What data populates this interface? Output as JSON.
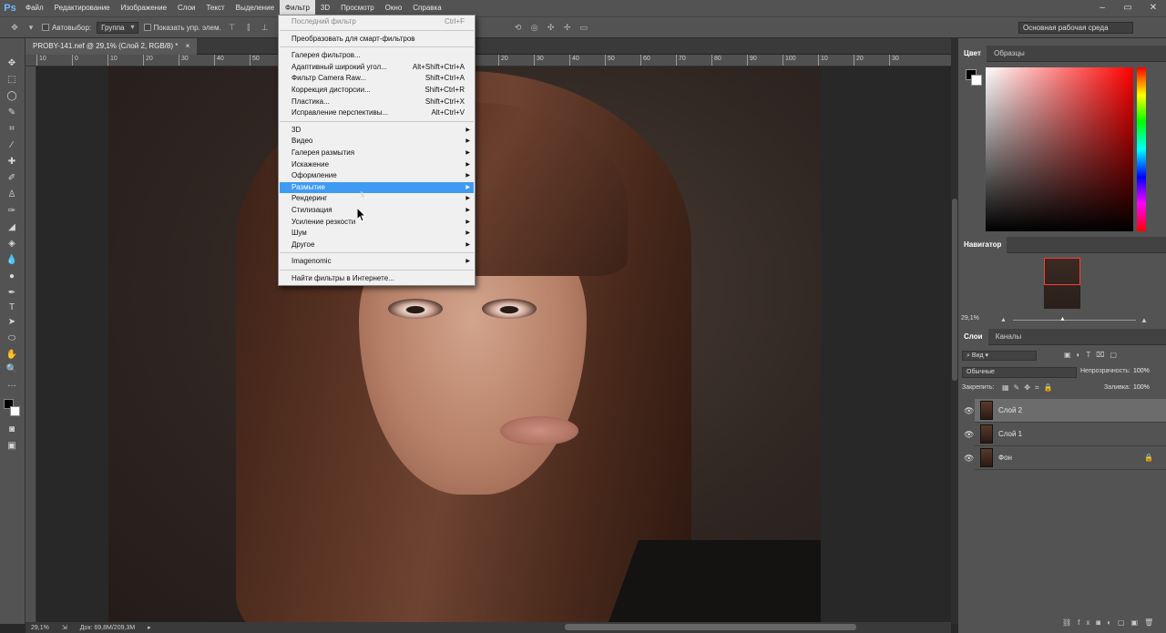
{
  "app": {
    "logo": "Ps"
  },
  "menubar": {
    "items": [
      "Файл",
      "Редактирование",
      "Изображение",
      "Слои",
      "Текст",
      "Выделение",
      "Фильтр",
      "3D",
      "Просмотр",
      "Окно",
      "Справка"
    ],
    "active_index": 6
  },
  "options": {
    "autoselect_label": "Автовыбор:",
    "autoselect_value": "Группа",
    "show_controls_label": "Показать упр. элем.",
    "workspace": "Основная рабочая среда"
  },
  "document": {
    "tab_title": "PROBY-141.nef @ 29,1% (Слой 2, RGB/8) *",
    "ruler_ticks": [
      "10",
      "0",
      "10",
      "20",
      "30",
      "40",
      "50",
      "60",
      "70",
      "80",
      "90",
      "100",
      "10",
      "20",
      "30",
      "40",
      "50",
      "60",
      "70",
      "80",
      "90",
      "100",
      "10",
      "20",
      "30"
    ]
  },
  "status": {
    "zoom": "29,1%",
    "doc": "Док: 69,8M/209,3M"
  },
  "filter_menu": {
    "items": [
      {
        "label": "Последний фильтр",
        "shortcut": "Ctrl+F",
        "disabled": true
      },
      {
        "sep": true
      },
      {
        "label": "Преобразовать для смарт-фильтров"
      },
      {
        "sep": true
      },
      {
        "label": "Галерея фильтров..."
      },
      {
        "label": "Адаптивный широкий угол...",
        "shortcut": "Alt+Shift+Ctrl+A"
      },
      {
        "label": "Фильтр Camera Raw...",
        "shortcut": "Shift+Ctrl+A"
      },
      {
        "label": "Коррекция дисторсии...",
        "shortcut": "Shift+Ctrl+R"
      },
      {
        "label": "Пластика...",
        "shortcut": "Shift+Ctrl+X"
      },
      {
        "label": "Исправление перспективы...",
        "shortcut": "Alt+Ctrl+V"
      },
      {
        "sep": true
      },
      {
        "label": "3D",
        "submenu": true
      },
      {
        "label": "Видео",
        "submenu": true
      },
      {
        "label": "Галерея размытия",
        "submenu": true
      },
      {
        "label": "Искажение",
        "submenu": true
      },
      {
        "label": "Оформление",
        "submenu": true
      },
      {
        "label": "Размытие",
        "submenu": true,
        "highlighted": true
      },
      {
        "label": "Рендеринг",
        "submenu": true
      },
      {
        "label": "Стилизация",
        "submenu": true
      },
      {
        "label": "Усиление резкости",
        "submenu": true
      },
      {
        "label": "Шум",
        "submenu": true
      },
      {
        "label": "Другое",
        "submenu": true
      },
      {
        "sep": true
      },
      {
        "label": "Imagenomic",
        "submenu": true
      },
      {
        "sep": true
      },
      {
        "label": "Найти фильтры в Интернете..."
      }
    ]
  },
  "color_panel": {
    "tabs": [
      "Цвет",
      "Образцы"
    ]
  },
  "navigator_panel": {
    "title": "Навигатор",
    "zoom": "29,1%"
  },
  "layers_panel": {
    "tabs": [
      "Слои",
      "Каналы"
    ],
    "filter_kind": "Вид",
    "blend_mode": "Обычные",
    "opacity_label": "Непрозрачность:",
    "opacity_value": "100%",
    "lock_label": "Закрепить:",
    "fill_label": "Заливка:",
    "fill_value": "100%",
    "layers": [
      {
        "name": "Слой 2",
        "selected": true
      },
      {
        "name": "Слой 1",
        "selected": false
      },
      {
        "name": "Фон",
        "selected": false,
        "locked": true
      }
    ]
  },
  "icons": {
    "move": "move-icon",
    "eye": "eye-icon",
    "lock": "lock-icon",
    "submenu": "chevron-right-icon"
  }
}
